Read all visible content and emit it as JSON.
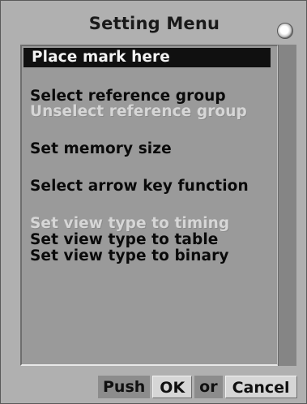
{
  "window": {
    "title": "Setting Menu"
  },
  "menu": {
    "items": [
      {
        "label": "Place mark here",
        "state": "selected"
      },
      {
        "label": "Select reference group",
        "state": "enabled"
      },
      {
        "label": "Unselect reference group",
        "state": "disabled"
      },
      {
        "label": "Set memory size",
        "state": "enabled"
      },
      {
        "label": "Select arrow key function",
        "state": "enabled"
      },
      {
        "label": "Set view type to timing",
        "state": "disabled"
      },
      {
        "label": "Set view type to table",
        "state": "enabled"
      },
      {
        "label": "Set view type to binary",
        "state": "enabled"
      }
    ]
  },
  "footer": {
    "push_label": "Push",
    "ok_label": "OK",
    "or_label": "or",
    "cancel_label": "Cancel"
  },
  "icons": {
    "close": "close-icon"
  },
  "colors": {
    "selected_bg": "#101010",
    "selected_text": "#f2f2f2",
    "disabled_text": "#d6d6d6"
  }
}
